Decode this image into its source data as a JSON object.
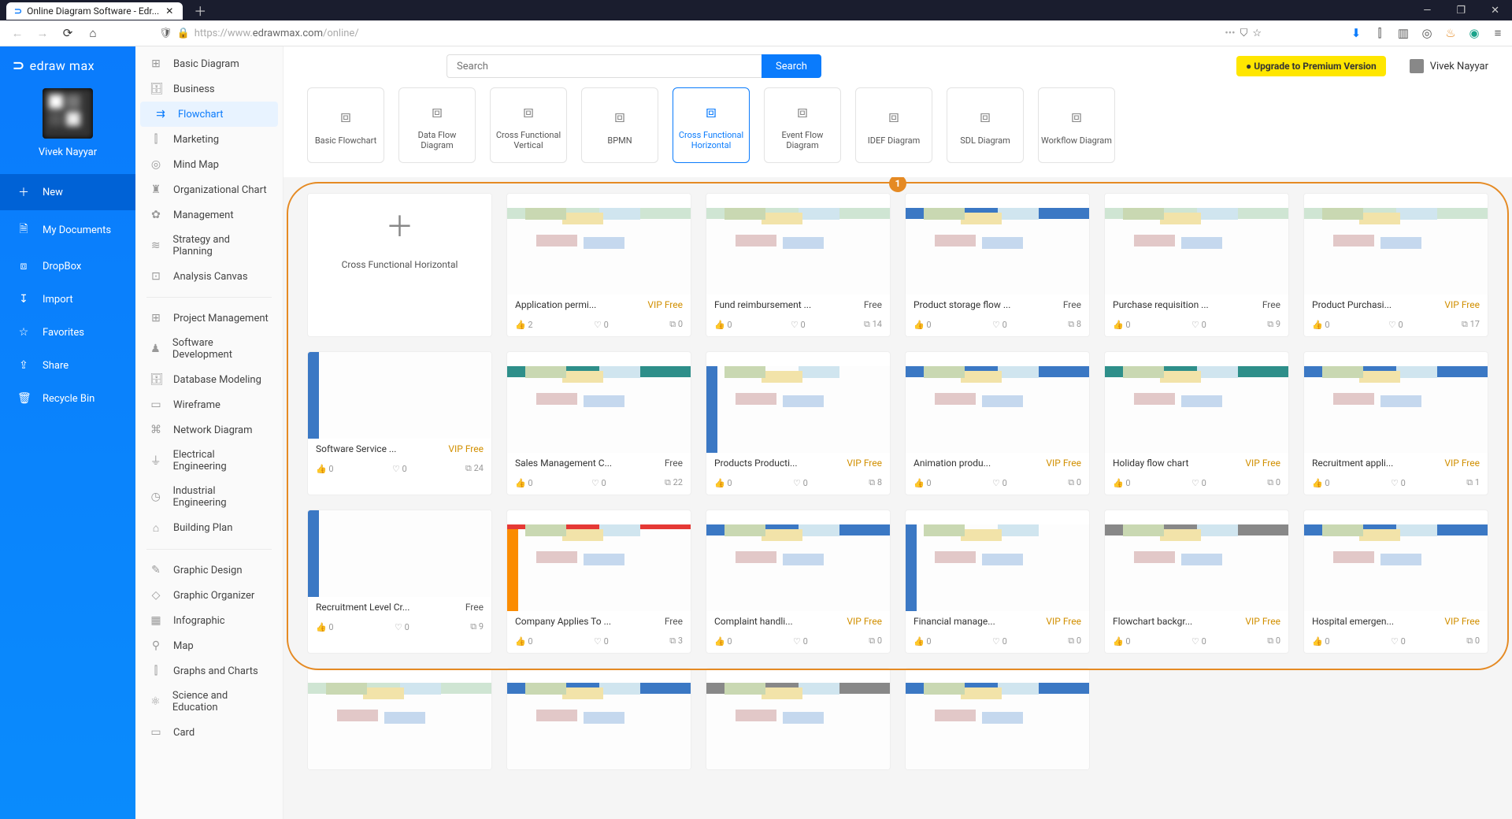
{
  "browser": {
    "tab_title": "Online Diagram Software - Edr...",
    "url_host": "https://www.",
    "url_main": "edrawmax.com",
    "url_path": "/online/"
  },
  "app": {
    "logo": "edraw max",
    "username": "Vivek Nayyar",
    "search_placeholder": "Search",
    "search_button": "Search",
    "upgrade": "● Upgrade to Premium Version",
    "header_user": "Vivek Nayyar"
  },
  "sidebar": {
    "items": [
      {
        "icon": "＋",
        "label": "New",
        "active": true
      },
      {
        "icon": "🗎",
        "label": "My Documents"
      },
      {
        "icon": "⧈",
        "label": "DropBox"
      },
      {
        "icon": "↧",
        "label": "Import"
      },
      {
        "icon": "☆",
        "label": "Favorites"
      },
      {
        "icon": "⇪",
        "label": "Share"
      },
      {
        "icon": "🗑",
        "label": "Recycle Bin"
      }
    ]
  },
  "categories": {
    "group1": [
      {
        "icon": "⊞",
        "label": "Basic Diagram"
      },
      {
        "icon": "🗄",
        "label": "Business"
      },
      {
        "icon": "⇉",
        "label": "Flowchart",
        "active": true
      },
      {
        "icon": "⫿",
        "label": "Marketing"
      },
      {
        "icon": "◎",
        "label": "Mind Map"
      },
      {
        "icon": "♜",
        "label": "Organizational Chart"
      },
      {
        "icon": "✿",
        "label": "Management"
      },
      {
        "icon": "≋",
        "label": "Strategy and Planning"
      },
      {
        "icon": "⊡",
        "label": "Analysis Canvas"
      }
    ],
    "group2": [
      {
        "icon": "⊞",
        "label": "Project Management"
      },
      {
        "icon": "♟",
        "label": "Software Development"
      },
      {
        "icon": "🗄",
        "label": "Database Modeling"
      },
      {
        "icon": "▭",
        "label": "Wireframe"
      },
      {
        "icon": "⌘",
        "label": "Network Diagram"
      },
      {
        "icon": "⏚",
        "label": "Electrical Engineering"
      },
      {
        "icon": "◷",
        "label": "Industrial Engineering"
      },
      {
        "icon": "⌂",
        "label": "Building Plan"
      }
    ],
    "group3": [
      {
        "icon": "✎",
        "label": "Graphic Design"
      },
      {
        "icon": "◇",
        "label": "Graphic Organizer"
      },
      {
        "icon": "▦",
        "label": "Infographic"
      },
      {
        "icon": "⚲",
        "label": "Map"
      },
      {
        "icon": "⫿",
        "label": "Graphs and Charts"
      },
      {
        "icon": "⚛",
        "label": "Science and Education"
      },
      {
        "icon": "▭",
        "label": "Card"
      }
    ]
  },
  "types": [
    {
      "label": "Basic Flowchart"
    },
    {
      "label": "Data Flow Diagram"
    },
    {
      "label": "Cross Functional Vertical"
    },
    {
      "label": "BPMN"
    },
    {
      "label": "Cross Functional Horizontal",
      "active": true
    },
    {
      "label": "Event Flow Diagram"
    },
    {
      "label": "IDEF Diagram"
    },
    {
      "label": "SDL Diagram"
    },
    {
      "label": "Workflow Diagram"
    }
  ],
  "new_tile": "Cross Functional Horizontal",
  "annotation_number": "1",
  "templates": [
    {
      "title": "Software Service ...",
      "badge": "VIP Free",
      "vip": true,
      "likes": 0,
      "hearts": 0,
      "copies": 24,
      "thumb": "th-blue-side",
      "col": 1
    },
    {
      "title": "Recruitment Level Cr...",
      "badge": "Free",
      "likes": 0,
      "hearts": 0,
      "copies": 9,
      "thumb": "th-blue-side",
      "col": 1
    },
    {
      "title": "Application permi...",
      "badge": "VIP Free",
      "vip": true,
      "likes": 2,
      "hearts": 0,
      "copies": 0,
      "thumb": "th-green th-boxes"
    },
    {
      "title": "Fund reimbursement ...",
      "badge": "Free",
      "likes": 0,
      "hearts": 0,
      "copies": 14,
      "thumb": "th-green th-boxes"
    },
    {
      "title": "Product storage flow ...",
      "badge": "Free",
      "likes": 0,
      "hearts": 0,
      "copies": 8,
      "thumb": "th-blue th-boxes"
    },
    {
      "title": "Purchase requisition ...",
      "badge": "Free",
      "likes": 0,
      "hearts": 0,
      "copies": 9,
      "thumb": "th-green th-boxes"
    },
    {
      "title": "Product Purchasi...",
      "badge": "VIP Free",
      "vip": true,
      "likes": 0,
      "hearts": 0,
      "copies": 17,
      "thumb": "th-green th-boxes"
    },
    {
      "title": "Sales Management C...",
      "badge": "Free",
      "likes": 0,
      "hearts": 0,
      "copies": 22,
      "thumb": "th-teal th-boxes"
    },
    {
      "title": "Products Producti...",
      "badge": "VIP Free",
      "vip": true,
      "likes": 0,
      "hearts": 0,
      "copies": 8,
      "thumb": "th-blue-side th-boxes"
    },
    {
      "title": "Animation produ...",
      "badge": "VIP Free",
      "vip": true,
      "likes": 0,
      "hearts": 0,
      "copies": 0,
      "thumb": "th-blue th-boxes"
    },
    {
      "title": "Holiday flow chart",
      "badge": "VIP Free",
      "vip": true,
      "likes": 0,
      "hearts": 0,
      "copies": 0,
      "thumb": "th-teal th-boxes"
    },
    {
      "title": "Recruitment appli...",
      "badge": "VIP Free",
      "vip": true,
      "likes": 0,
      "hearts": 0,
      "copies": 1,
      "thumb": "th-blue th-boxes"
    },
    {
      "title": "Company Applies To ...",
      "badge": "Free",
      "likes": 0,
      "hearts": 0,
      "copies": 3,
      "thumb": "th-orange th-boxes"
    },
    {
      "title": "Complaint handli...",
      "badge": "VIP Free",
      "vip": true,
      "likes": 0,
      "hearts": 0,
      "copies": 0,
      "thumb": "th-blue th-boxes"
    },
    {
      "title": "Financial manage...",
      "badge": "VIP Free",
      "vip": true,
      "likes": 0,
      "hearts": 0,
      "copies": 0,
      "thumb": "th-blue-side th-boxes"
    },
    {
      "title": "Flowchart backgr...",
      "badge": "VIP Free",
      "vip": true,
      "likes": 0,
      "hearts": 0,
      "copies": 0,
      "thumb": "th-dark th-boxes"
    },
    {
      "title": "Hospital emergen...",
      "badge": "VIP Free",
      "vip": true,
      "likes": 0,
      "hearts": 0,
      "copies": 0,
      "thumb": "th-blue th-boxes"
    }
  ]
}
